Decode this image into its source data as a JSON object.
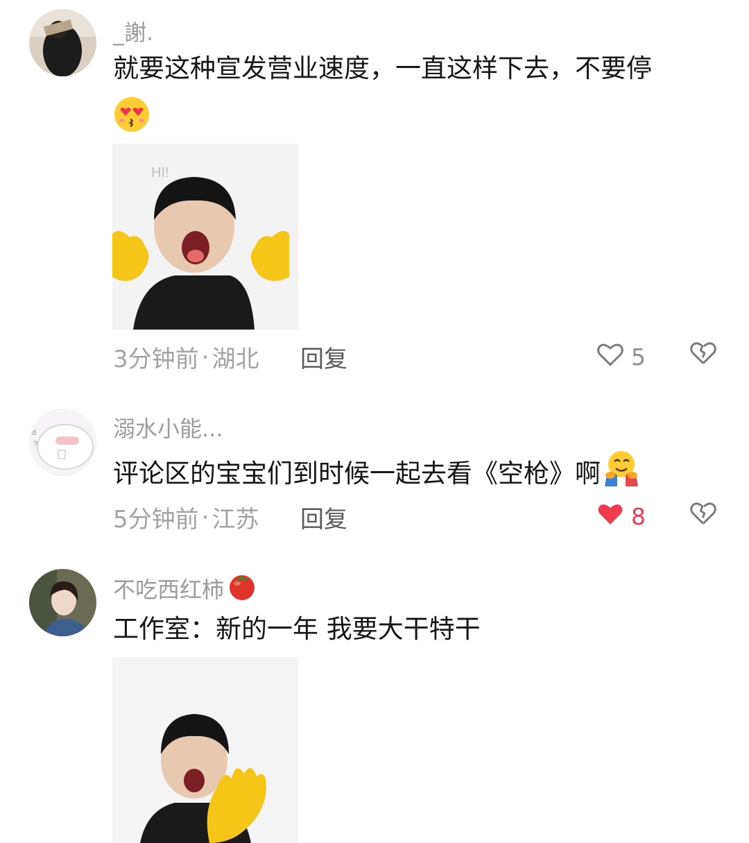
{
  "comments": [
    {
      "username": "_謝.",
      "text": "就要这种宣发营业速度，一直这样下去，不要停",
      "emoji_line_icon": "heart-eyes-kiss-emoji-icon",
      "sticker_caption": "HI!",
      "time": "3分钟前",
      "separator": "·",
      "location": "湖北",
      "reply_label": "回复",
      "likes": "5",
      "liked": false
    },
    {
      "username": "溺水小能...",
      "text": "评论区的宝宝们到时候一起去看《空枪》啊",
      "trailing_emoji_icon": "hugging-face-emoji-icon",
      "time": "5分钟前",
      "separator": "·",
      "location": "江苏",
      "reply_label": "回复",
      "likes": "8",
      "liked": true
    },
    {
      "username": "不吃西红柿",
      "username_emoji_icon": "tomato-emoji-icon",
      "text": "工作室：新的一年 我要大干特干"
    }
  ],
  "colors": {
    "like_active": "#ef3b4f",
    "meta_gray": "#a3a3a3",
    "username_gray": "#9b9b9b",
    "text_dark": "#161616"
  }
}
